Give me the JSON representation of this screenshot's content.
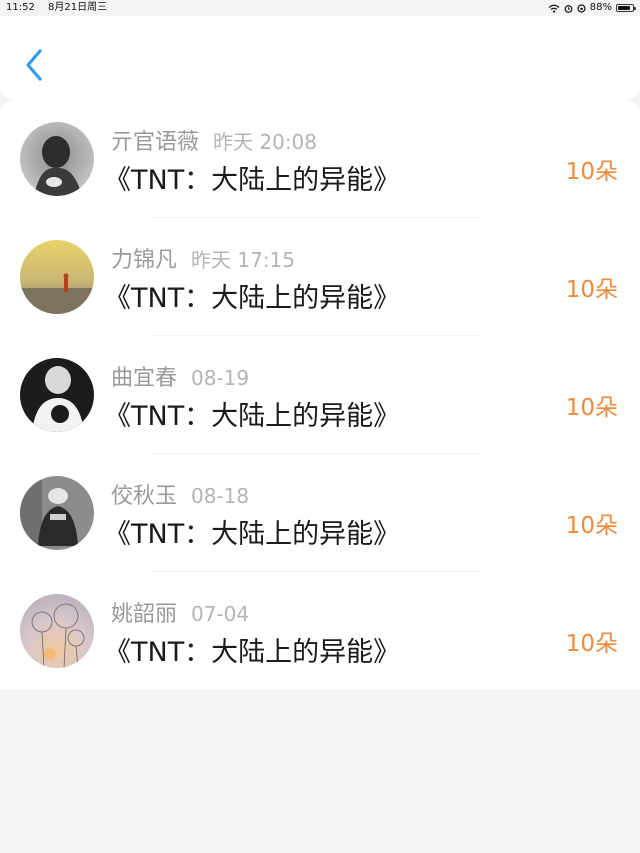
{
  "status": {
    "time": "11:52",
    "date": "8月21日周三",
    "battery_percent": "88%",
    "battery_level": 0.88
  },
  "header": {
    "back_icon": "chevron-left-icon",
    "accent_color": "#2f9cf0"
  },
  "list": [
    {
      "name": "亓官语薇",
      "time": "昨天 20:08",
      "book": "《TNT：大陆上的异能》",
      "amount": "10朵"
    },
    {
      "name": "力锦凡",
      "time": "昨天 17:15",
      "book": "《TNT：大陆上的异能》",
      "amount": "10朵"
    },
    {
      "name": "曲宜春",
      "time": "08-19",
      "book": "《TNT：大陆上的异能》",
      "amount": "10朵"
    },
    {
      "name": "佼秋玉",
      "time": "08-18",
      "book": "《TNT：大陆上的异能》",
      "amount": "10朵"
    },
    {
      "name": "姚韶丽",
      "time": "07-04",
      "book": "《TNT：大陆上的异能》",
      "amount": "10朵"
    }
  ],
  "colors": {
    "amount": "#ee8a3a",
    "name": "#9a9a9a",
    "time": "#b4b4b4",
    "book": "#1b1b1b",
    "background": "#f4f4f4"
  }
}
